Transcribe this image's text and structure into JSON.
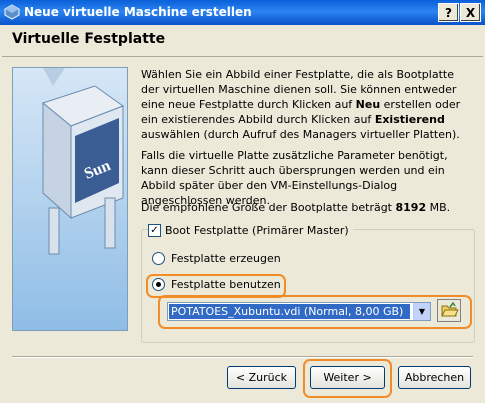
{
  "window": {
    "title": "Neue virtuelle Maschine erstellen",
    "help_label": "?",
    "close_label": "X"
  },
  "page": {
    "title": "Virtuelle Festplatte"
  },
  "intro": {
    "p1_a": "Wählen Sie ein Abbild einer Festplatte, die als Bootplatte der virtuellen Maschine dienen soll. Sie können entweder eine neue Festplatte durch Klicken auf ",
    "p1_b": "Neu",
    "p1_c": " erstellen oder ein existierendes Abbild durch Klicken auf ",
    "p1_d": "Existierend",
    "p1_e": " auswählen (durch Aufruf des Managers virtueller Platten).",
    "p2": "Falls die virtuelle Platte zusätzliche Parameter benötigt, kann dieser Schritt auch übersprungen werden und ein Abbild später über den VM-Einstellungs-Dialog angeschlossen werden.",
    "p3_a": "Die empfohlene Größe der Bootplatte beträgt ",
    "p3_b": "8192",
    "p3_c": " MB."
  },
  "boot_group": {
    "checkbox_label": "Boot Festplatte (Primärer Master)",
    "checked": true
  },
  "options": {
    "create_label": "Festplatte erzeugen",
    "use_label": "Festplatte benutzen",
    "selected": "use"
  },
  "disk_select": {
    "value": "POTATOES_Xubuntu.vdi (Normal, 8,00 GB)"
  },
  "buttons": {
    "back": "< Zurück",
    "next": "Weiter >",
    "cancel": "Abbrechen"
  },
  "highlight_color": "#f28c28",
  "icons": {
    "app": "virtualbox-icon",
    "folder": "open-folder-icon",
    "dropdown": "chevron-down-icon"
  }
}
